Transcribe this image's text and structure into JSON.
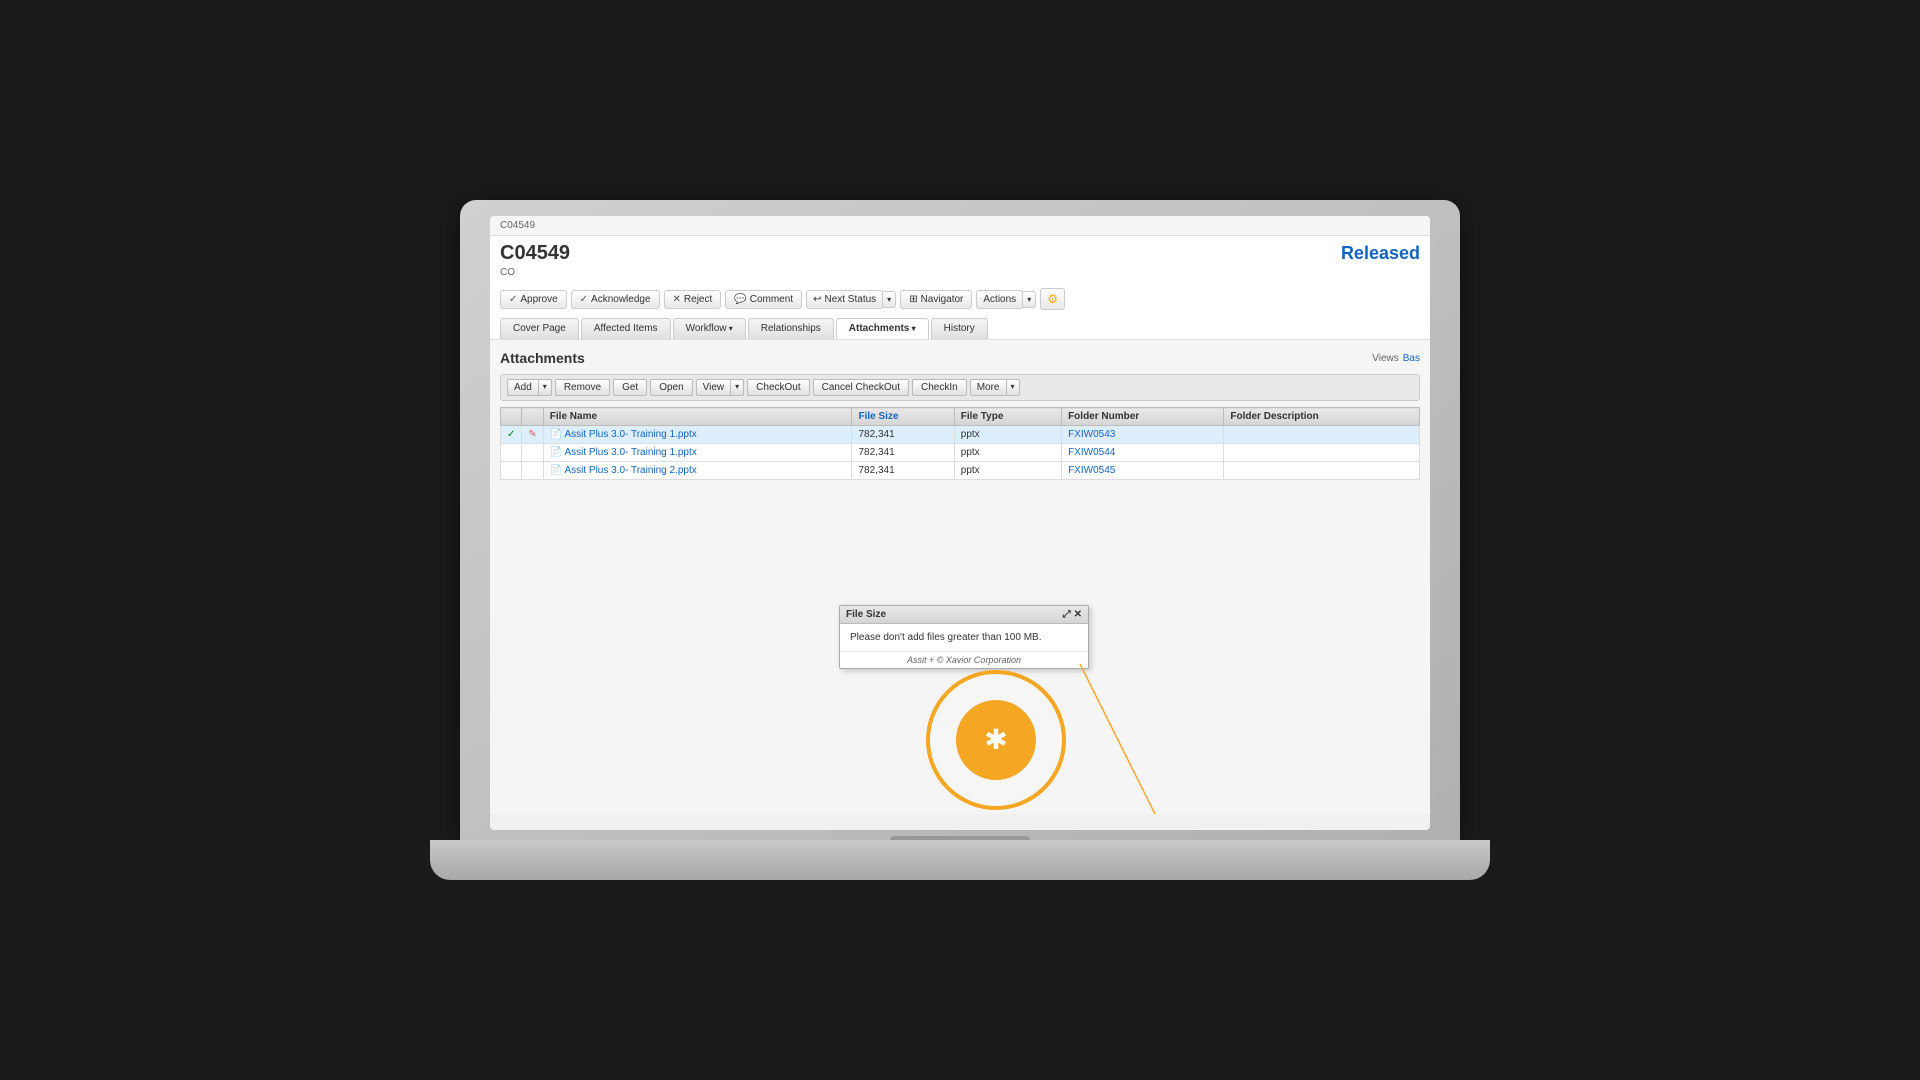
{
  "window": {
    "title": "C04549",
    "doc_id": "C04549",
    "doc_sub": "CO",
    "status": "Released",
    "status_color": "#1565C0"
  },
  "toolbar": {
    "approve": "Approve",
    "acknowledge": "Acknowledge",
    "reject": "Reject",
    "comment": "Comment",
    "next_status": "Next Status",
    "navigator": "Navigator",
    "actions": "Actions"
  },
  "tabs": [
    {
      "label": "Cover Page",
      "active": false
    },
    {
      "label": "Affected Items",
      "active": false
    },
    {
      "label": "Workflow",
      "active": false,
      "has_arrow": true
    },
    {
      "label": "Relationships",
      "active": false
    },
    {
      "label": "Attachments",
      "active": true,
      "has_arrow": true
    },
    {
      "label": "History",
      "active": false
    }
  ],
  "attachments_section": {
    "title": "Attachments",
    "views_label": "Views",
    "views_value": "Bas"
  },
  "attachments_toolbar": {
    "add": "Add",
    "remove": "Remove",
    "get": "Get",
    "open": "Open",
    "view": "View",
    "checkout": "CheckOut",
    "cancel_checkout": "Cancel CheckOut",
    "checkin": "CheckIn",
    "more": "More"
  },
  "table": {
    "columns": [
      "",
      "",
      "File Name",
      "File Size",
      "File Type",
      "Folder Number",
      "Folder Description"
    ],
    "rows": [
      {
        "selected": true,
        "check": true,
        "edit": true,
        "name": "Assit Plus 3.0- Training 1.pptx",
        "file_size": "782,341",
        "file_type": "pptx",
        "folder_number": "FXIW0543",
        "folder_desc": ""
      },
      {
        "selected": false,
        "check": false,
        "edit": false,
        "name": "Assit Plus 3.0- Training 1.pptx",
        "file_size": "782,341",
        "file_type": "pptx",
        "folder_number": "FXIW0544",
        "folder_desc": ""
      },
      {
        "selected": false,
        "check": false,
        "edit": false,
        "name": "Assit Plus 3.0- Training 2.pptx",
        "file_size": "782,341",
        "file_type": "pptx",
        "folder_number": "FXIW0545",
        "folder_desc": ""
      }
    ]
  },
  "tooltip": {
    "title": "File Size",
    "message": "Please don't add files greater than 100 MB.",
    "footer": "Assit + © Xavior Corporation",
    "icons": [
      "resize-icon",
      "close-icon"
    ]
  },
  "overlay": {
    "icon": "★"
  }
}
